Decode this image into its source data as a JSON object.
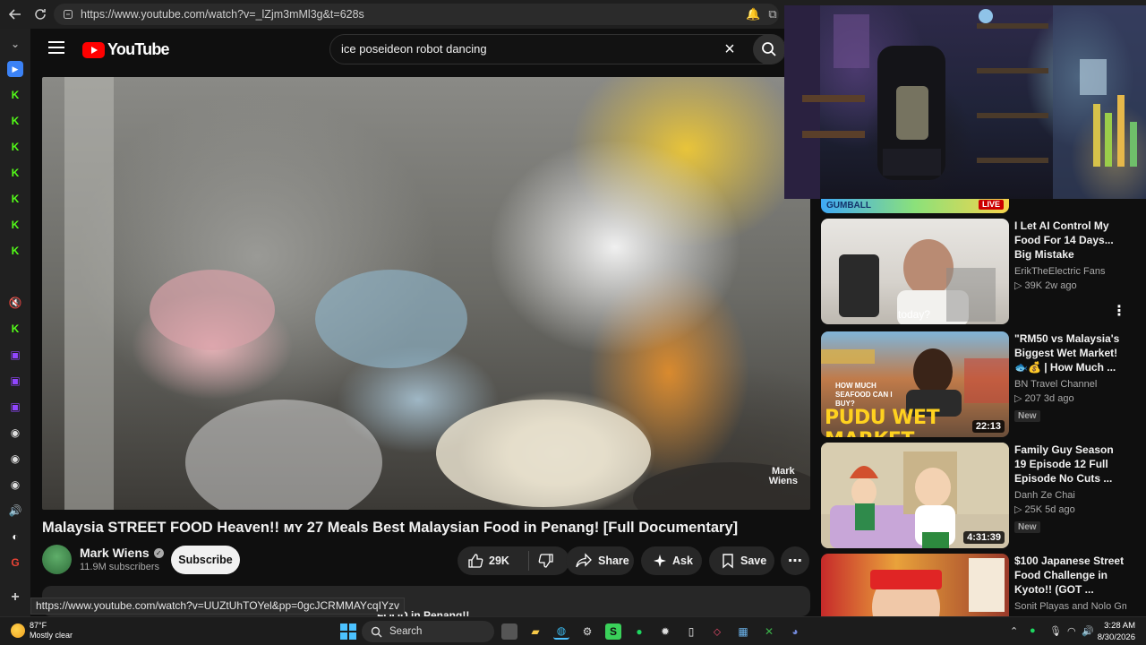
{
  "browser": {
    "url": "https://www.youtube.com/watch?v=_lZjm3mMl3g&t=628s",
    "hover_url": "https://www.youtube.com/watch?v=UUZtUhTOYel&pp=0gcJCRMMAYcqIYzv"
  },
  "youtube": {
    "logo_text": "YouTube",
    "search_query": "ice poseideon robot dancing"
  },
  "video": {
    "watermark": "Mark\nWiens",
    "title": "Malaysia STREET FOOD Heaven!! ᴍʏ 27 Meals Best Malaysian Food in Penang! [Full Documentary]",
    "channel": "Mark Wiens",
    "subscribers": "11.9M subscribers",
    "subscribe_label": "Subscribe",
    "likes": "29K",
    "share_label": "Share",
    "ask_label": "Ask",
    "save_label": "Save",
    "desc_peek": "FOOD in Penang!!"
  },
  "recommendations": {
    "top_live_badge": "LIVE",
    "top_live_brand": "GUMBALL",
    "items": [
      {
        "title": "I Let AI Control My Food For 14 Days... Big Mistake",
        "channel": "ErikTheElectric Fans",
        "meta": "▷ 39K  2w ago",
        "caption": "today?",
        "duration": "",
        "badge": ""
      },
      {
        "title": "\"RM50 vs Malaysia's Biggest Wet Market! 🐟💰 | How Much ...",
        "channel": "BN Travel Channel",
        "meta": "▷ 207  3d ago",
        "thumb_text_small": "HOW MUCH SEAFOOD CAN I BUY?",
        "thumb_text_big": "PUDU WET MARKET",
        "duration": "22:13",
        "badge": "New"
      },
      {
        "title": "Family Guy Season 19 Episode 12 Full Episode No Cuts ...",
        "channel": "Danh Ze Chai",
        "meta": "▷ 25K  5d ago",
        "duration": "4:31:39",
        "badge": "New"
      },
      {
        "title": "$100 Japanese Street Food Challenge in Kyoto!! (GOT ...",
        "channel": "Sonit Playas and Nolo Gm...",
        "meta": "",
        "duration": "",
        "badge": ""
      }
    ]
  },
  "taskbar": {
    "temp": "87°F",
    "weather": "Mostly clear",
    "search": "Search",
    "time": "3:28 AM",
    "date": "8/30/2026"
  },
  "colors": {
    "yt_red": "#ff0000",
    "bg": "#0f0f0f",
    "pill": "#272727",
    "accent_blue": "#4cc2ff"
  }
}
